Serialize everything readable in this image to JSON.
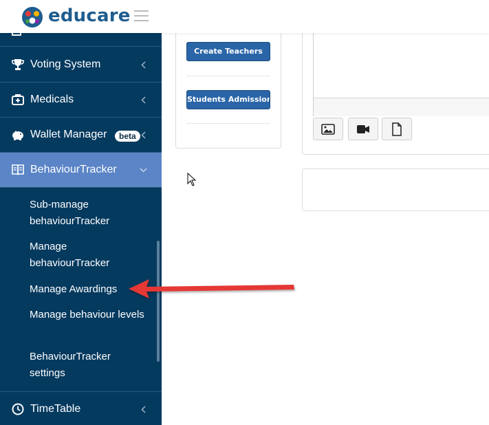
{
  "header": {
    "brand": "educare",
    "logo_icon": "educare-logo",
    "menu_icon": "hamburger-icon"
  },
  "sidebar": {
    "items": [
      {
        "label": "Voting System",
        "icon": "trophy-icon"
      },
      {
        "label": "Medicals",
        "icon": "medical-kit-icon"
      },
      {
        "label": "Wallet Manager",
        "icon": "piggy-bank-icon",
        "badge": "beta"
      },
      {
        "label": "BehaviourTracker",
        "icon": "book-icon",
        "active": true
      }
    ],
    "submenu": [
      {
        "label": "Sub-manage behaviourTracker"
      },
      {
        "label": "Manage behaviourTracker"
      },
      {
        "label": "Manage Awardings"
      },
      {
        "label": "Manage behaviour levels"
      },
      {
        "label": "BehaviourTracker settings"
      }
    ],
    "timetable": {
      "label": "TimeTable",
      "icon": "clock-icon"
    }
  },
  "main": {
    "buttons": {
      "create_teachers": "Create Teachers",
      "students_admission": "Students Admission"
    },
    "editor_tools": [
      "image-icon",
      "video-icon",
      "file-icon"
    ]
  },
  "colors": {
    "sidebar_bg": "#053a5f",
    "sidebar_active": "#5b85c6",
    "button_blue": "#2a65a7",
    "brand": "#1f5d8f",
    "annotation_arrow": "#e53935"
  }
}
